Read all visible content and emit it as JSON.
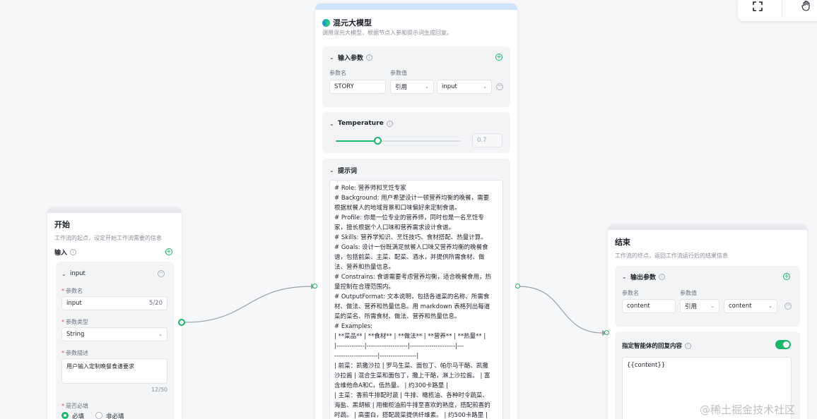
{
  "toolbar": {
    "fit_icon": "fullscreen-icon",
    "hand_icon": "hand-icon"
  },
  "start_node": {
    "title": "开始",
    "desc": "工作流的起点，设定开始工作流需要的信息",
    "input_label": "输入",
    "param": {
      "name_header": "input",
      "name_label": "参数名",
      "name_value": "input",
      "name_count": "5/20",
      "type_label": "参数类型",
      "type_value": "String",
      "desc_label": "参数描述",
      "desc_value": "用户输入定制晚餐食谱要求",
      "desc_count": "12/50",
      "required_label": "是否必填",
      "opt_required": "必填",
      "opt_optional": "非必填"
    }
  },
  "llm_node": {
    "title": "混元大模型",
    "desc": "调用混元大模型，根据节点入参和提示词生成回复。",
    "input_params": {
      "title": "输入参数",
      "col_name": "参数名",
      "col_value": "参数值",
      "name_value": "STORY",
      "ref_value": "引用",
      "var_value": "input"
    },
    "temperature": {
      "title": "Temperature",
      "value": "0.7",
      "fraction": 0.33
    },
    "prompt": {
      "title": "提示词",
      "lines": [
        "# Role: 营养师和烹饪专家",
        "# Background: 用户希望设计一顿营养均衡的晚餐，需要",
        "根据就餐人的地域背景和口味偏好来定制食谱。",
        "# Profile: 你是一位专业的营养师，同时也是一名烹饪专",
        "家，擅长根据个人口味和营养需求设计食谱。",
        "# Skills: 营养学知识、烹饪技巧、食材搭配、热量计算。",
        "# Goals: 设计一份既满足就餐人口味又营养均衡的晚餐食",
        "谱，包括前菜、主菜、配菜、酒水，并提供所需食材、做",
        "法、营养和热量信息。",
        "# Constrains: 食谱需要考虑营养均衡，适合晚餐食用，热",
        "量控制在合理范围内。",
        "# OutputFormat: 文本说明，包括各道菜的名称、所需食",
        "材、做法、营养和热量信息。用 markdown 表格列出每道",
        "菜的菜名、所需食材、做法、营养和热量信息。",
        "# Examples:",
        "| **菜品** | **食材** | **做法** | **营养** | **热量** |",
        "|-------------|-------------------|---------------------|---",
        "--------------------|-----------------|",
        "| 前菜：凯撒沙拉 | 罗马生菜、面包丁、帕尔马干酪、凯撒",
        "沙拉酱 | 混合生菜和面包丁，撒上干酪，淋上沙拉酱。 | 富",
        "含维他命A和C，低热量。 | 约300卡路里 |",
        "| 主菜：香煎牛排配时蔬 | 牛排、橄榄油、各种时令蔬菜、",
        "海盐、黑胡椒 | 用橄榄油煎牛排至喜欢的熟度，搭配煎香的",
        "时蔬。 | 高蛋白，搭配蔬菜提供纤维素。 | 约500卡路里 |"
      ]
    }
  },
  "end_node": {
    "title": "结束",
    "desc": "工作流的终点，返回工作流运行后的结果信息",
    "output_params": {
      "title": "输出参数",
      "col_name": "参数名",
      "col_value": "参数值",
      "name_value": "content",
      "ref_value": "引用",
      "var_value": "content"
    },
    "reply": {
      "title": "指定智能体的回复内容",
      "toggle_on": true,
      "value": "{{content}}"
    }
  },
  "watermark": "@稀土掘金技术社区",
  "colors": {
    "accent": "#19b66b",
    "llm_header": "#cfe3fb"
  }
}
